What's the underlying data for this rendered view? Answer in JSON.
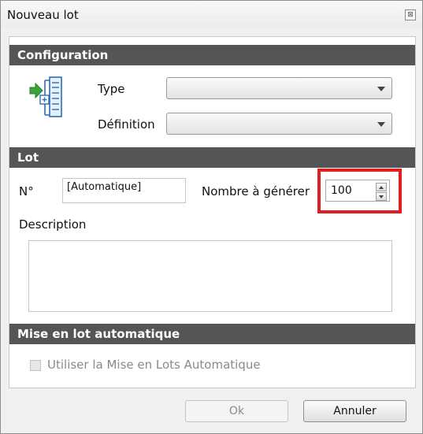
{
  "window": {
    "title": "Nouveau lot",
    "close_glyph": "⊠"
  },
  "configuration": {
    "header": "Configuration",
    "icon": "batch-definition-icon",
    "type_label": "Type",
    "type_value": "",
    "definition_label": "Définition",
    "definition_value": ""
  },
  "lot": {
    "header": "Lot",
    "number_label": "N°",
    "number_value": "[Automatique]",
    "count_label": "Nombre à générer",
    "count_value": "100",
    "description_label": "Description",
    "description_value": ""
  },
  "auto_batch": {
    "header": "Mise en lot automatique",
    "checkbox_label": "Utiliser la Mise en Lots Automatique",
    "checked": false
  },
  "buttons": {
    "ok": "Ok",
    "cancel": "Annuler"
  },
  "colors": {
    "section_header": "#555555",
    "highlight": "#e02020",
    "icon_arrow": "#3aa43a",
    "icon_blue": "#2d6fb0"
  }
}
